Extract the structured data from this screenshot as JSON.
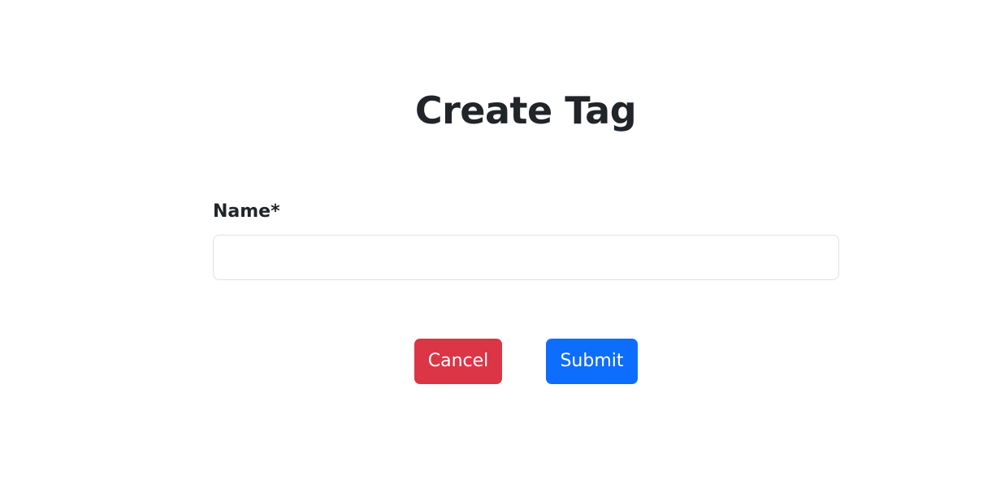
{
  "page": {
    "title": "Create Tag"
  },
  "form": {
    "name_label": "Name*",
    "name_value": "",
    "name_placeholder": ""
  },
  "actions": {
    "cancel_label": "Cancel",
    "submit_label": "Submit"
  },
  "colors": {
    "cancel": "#dc3545",
    "submit": "#0d6efd",
    "text": "#212529",
    "input_border": "#dee2e6"
  }
}
